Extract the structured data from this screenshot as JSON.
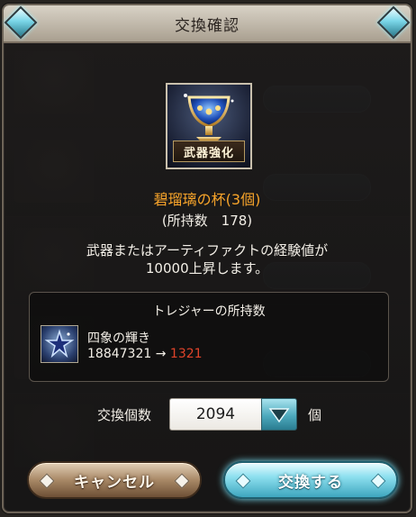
{
  "dialog": {
    "title": "交換確認"
  },
  "item": {
    "icon": "chalice-icon",
    "banner": "武器強化",
    "name": "碧瑠璃の杯(3個)",
    "owned_text": "(所持数　178)",
    "description_line1": "武器またはアーティファクトの経験値が",
    "description_line2": "10000上昇します。"
  },
  "treasure": {
    "heading": "トレジャーの所持数",
    "icon": "star-gem-icon",
    "name": "四象の輝き",
    "current": "18847321",
    "arrow": "→",
    "after": "1321"
  },
  "quantity": {
    "label": "交換個数",
    "value": "2094",
    "unit": "個"
  },
  "buttons": {
    "cancel": "キャンセル",
    "confirm": "交換する"
  },
  "colors": {
    "item_name": "#f7a42a",
    "count_after": "#e0432a",
    "confirm_button": "#8ee0ef",
    "cancel_button": "#a88866"
  }
}
